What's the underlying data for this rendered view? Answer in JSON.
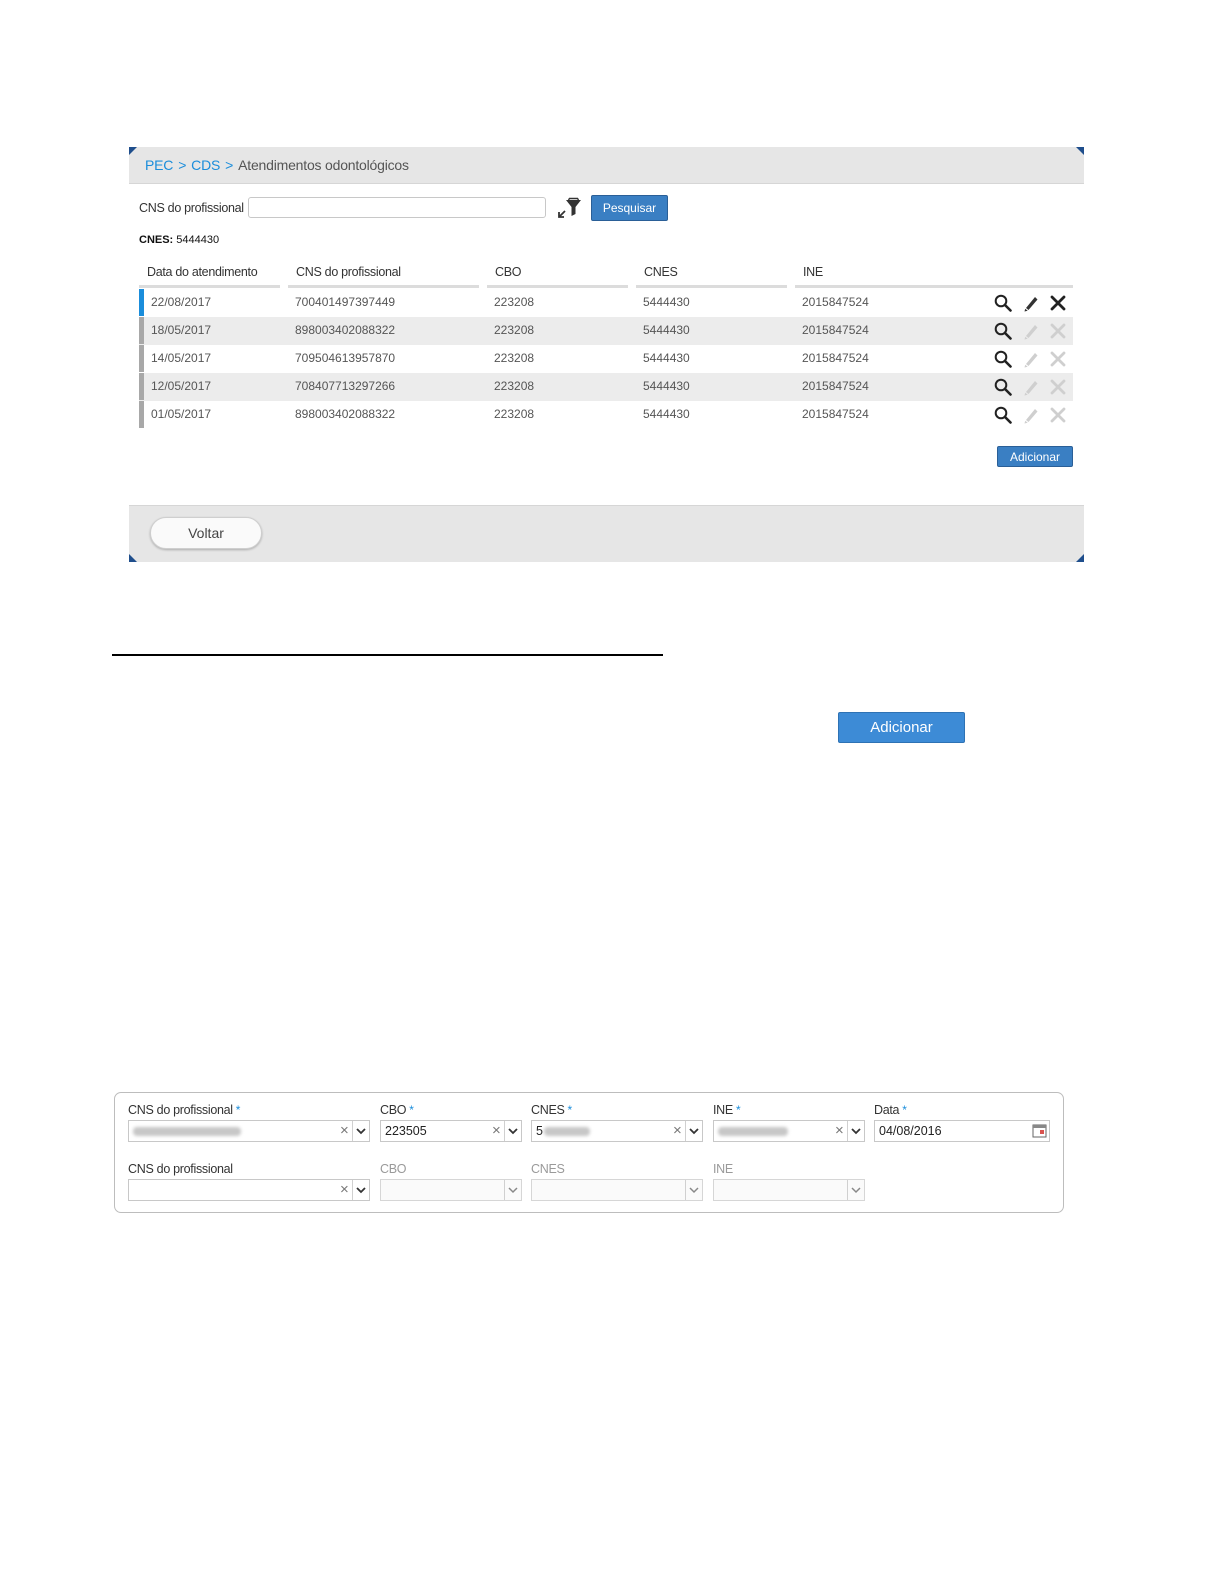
{
  "breadcrumb": {
    "item1": "PEC",
    "sep1": ">",
    "item2": "CDS",
    "sep2": ">",
    "current": "Atendimentos odontológicos"
  },
  "filter": {
    "label": "CNS do profissional",
    "value": "",
    "button": "Pesquisar"
  },
  "cnes_info": {
    "label": "CNES:",
    "value": "5444430"
  },
  "table": {
    "headers": [
      "Data do atendimento",
      "CNS do profissional",
      "CBO",
      "CNES",
      "INE"
    ],
    "rows": [
      {
        "date": "22/08/2017",
        "cns": "700401497397449",
        "cbo": "223208",
        "cnes": "5444430",
        "ine": "2015847524",
        "actions_enabled": true
      },
      {
        "date": "18/05/2017",
        "cns": "898003402088322",
        "cbo": "223208",
        "cnes": "5444430",
        "ine": "2015847524",
        "actions_enabled": false
      },
      {
        "date": "14/05/2017",
        "cns": "709504613957870",
        "cbo": "223208",
        "cnes": "5444430",
        "ine": "2015847524",
        "actions_enabled": false
      },
      {
        "date": "12/05/2017",
        "cns": "708407713297266",
        "cbo": "223208",
        "cnes": "5444430",
        "ine": "2015847524",
        "actions_enabled": false
      },
      {
        "date": "01/05/2017",
        "cns": "898003402088322",
        "cbo": "223208",
        "cnes": "5444430",
        "ine": "2015847524",
        "actions_enabled": false
      }
    ],
    "action_icons": [
      "search-icon",
      "pencil-icon",
      "close-icon"
    ]
  },
  "add_button_small": "Adicionar",
  "back_button": "Voltar",
  "add_button_large": "Adicionar",
  "form": {
    "row1": {
      "cns_label": "CNS do profissional",
      "cbo_label": "CBO",
      "cnes_label": "CNES",
      "ine_label": "INE",
      "data_label": "Data",
      "required_mark": "*",
      "cbo_value": "223505",
      "cnes_value": "5",
      "data_value": "04/08/2016"
    },
    "row2": {
      "cns_label": "CNS do profissional",
      "cbo_label": "CBO",
      "cnes_label": "CNES",
      "ine_label": "INE"
    },
    "clear_glyph": "×"
  },
  "colors": {
    "accent": "#1a8ddb",
    "button_blue": "#3a7fc3",
    "panel_gray": "#e6e6e6",
    "corner_navy": "#1f4e8c"
  }
}
